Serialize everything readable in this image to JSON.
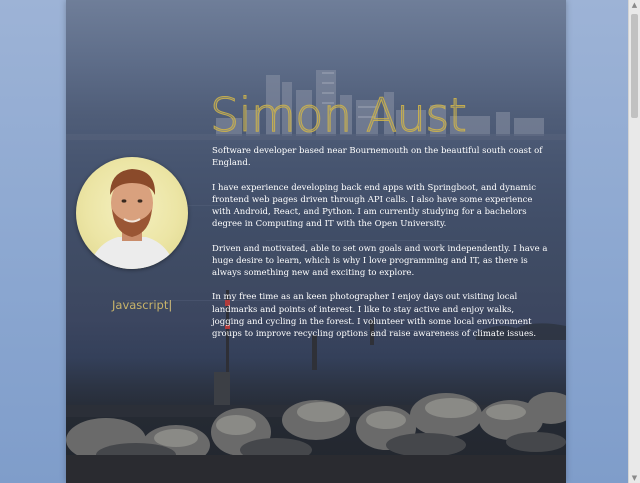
{
  "profile": {
    "name": "Simon Aust",
    "typed_skill": "Javascript",
    "cursor": "|"
  },
  "bio": {
    "paragraphs": [
      "Software developer based near Bournemouth on the beautiful south coast of England.",
      "I have experience developing back end apps with Springboot, and dynamic frontend web pages driven through API calls. I also have some experience with Android, React, and Python. I am currently studying for a bachelors degree in Computing and IT with the Open University.",
      "Driven and motivated, able to set own goals and work independently. I have a huge desire to learn, which is why I love programming and IT, as there is always something new and exciting to explore.",
      "In my free time as an keen photographer I enjoy days out visiting local landmarks and points of interest. I like to stay active and enjoy walks, jogging and cycling in the forest. I volunteer with some local environment groups to improve recycling options and raise awareness of climate issues."
    ]
  },
  "icons": {
    "scroll_up": "scroll-up-arrow-icon",
    "scroll_down": "scroll-down-arrow-icon"
  },
  "colors": {
    "accent": "#cdb24b",
    "page_background": "#8aa6d0"
  }
}
